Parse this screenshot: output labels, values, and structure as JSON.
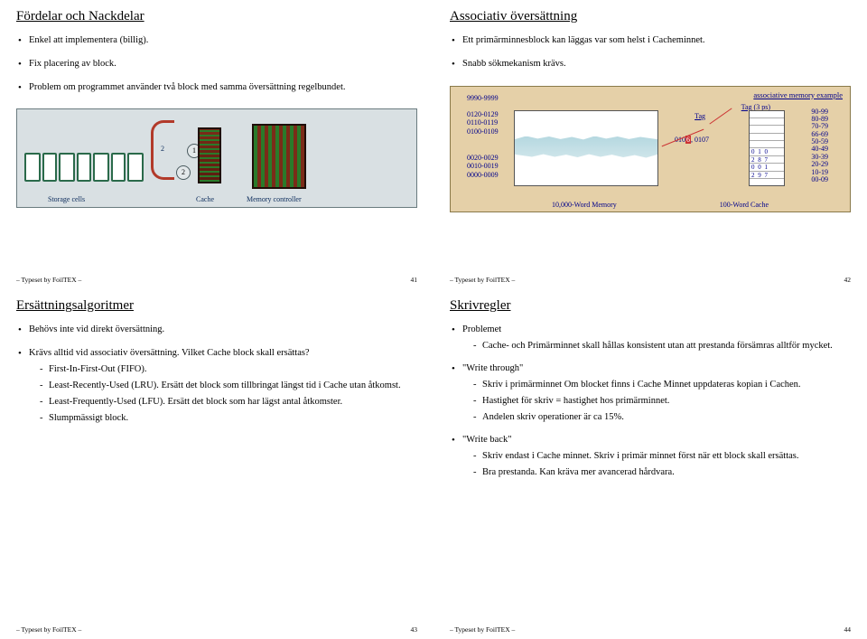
{
  "slides": {
    "s41": {
      "title": "Fördelar och Nackdelar",
      "bullets": [
        "Enkel att implementera (billig).",
        "Fix placering av block.",
        "Problem om programmet använder två block med samma översättning regelbundet."
      ],
      "fig_labels": {
        "storage": "Storage cells",
        "cache": "Cache",
        "mem": "Memory controller",
        "n1": "1",
        "n2": "2"
      },
      "footer_left": "– Typeset by FoilTEX –",
      "page": "41"
    },
    "s42": {
      "title": "Associativ översättning",
      "bullets": [
        "Ett primärminnesblock kan läggas var som helst i Cacheminnet.",
        "Snabb sökmekanism krävs."
      ],
      "fig": {
        "assoc_label": "associative memory example",
        "tag_ps": "Tag (3 ps)",
        "tag": "Tag",
        "topnum": "9990-9999",
        "left_nums_a": [
          "0120-0129",
          "0110-0119",
          "0100-0109"
        ],
        "left_nums_b": [
          "0020-0029",
          "0010-0019",
          "0000-0009"
        ],
        "tag_val_pre": "010",
        "tag_val_hl": "6",
        "tag_val_post": ", 0107",
        "right_rows": [
          "",
          "0 1 0",
          "2 8 7",
          "0 0 1",
          "2 9 7"
        ],
        "right_nums": [
          "90-99",
          "80-89",
          "70-79",
          "66-69",
          "50-59",
          "40-49",
          "30-39",
          "20-29",
          "10-19",
          "00-09"
        ],
        "bot_left": "10,000-Word Memory",
        "bot_right": "100-Word Cache"
      },
      "footer_left": "– Typeset by FoilTEX –",
      "page": "42"
    },
    "s43": {
      "title": "Ersättningsalgoritmer",
      "bullets": [
        "Behövs inte vid direkt översättning.",
        "Krävs alltid vid associativ översättning. Vilket Cache block skall ersättas?"
      ],
      "dashes": [
        "First-In-First-Out (FIFO).",
        "Least-Recently-Used (LRU). Ersätt det block som tillbringat längst tid i Cache utan åtkomst.",
        "Least-Frequently-Used (LFU). Ersätt det block som har lägst antal åtkomster.",
        "Slumpmässigt block."
      ],
      "footer_left": "– Typeset by FoilTEX –",
      "page": "43"
    },
    "s44": {
      "title": "Skrivregler",
      "b1": "Problemet",
      "b1_dashes": [
        "Cache- och Primärminnet skall hållas konsistent utan att prestanda försämras alltför mycket."
      ],
      "b2": "\"Write through\"",
      "b2_dashes": [
        "Skriv i primärminnet Om blocket finns i Cache Minnet uppdateras kopian i Cachen.",
        "Hastighet för skriv = hastighet hos primärminnet.",
        "Andelen skriv operationer är ca 15%."
      ],
      "b3": "\"Write back\"",
      "b3_dashes": [
        "Skriv endast i Cache minnet. Skriv i primär minnet först när ett block skall ersättas.",
        "Bra prestanda. Kan kräva mer avancerad hårdvara."
      ],
      "footer_left": "– Typeset by FoilTEX –",
      "page": "44"
    }
  }
}
